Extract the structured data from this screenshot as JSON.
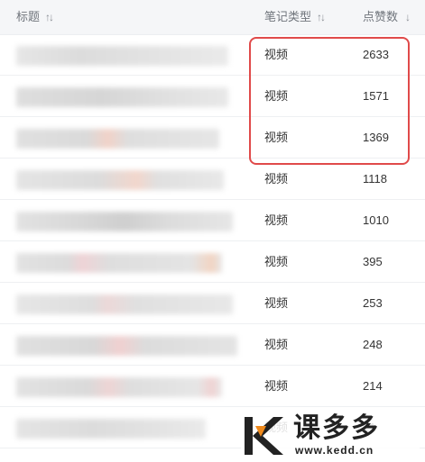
{
  "header": {
    "title_col": "标题",
    "type_col": "笔记类型",
    "likes_col": "点赞数"
  },
  "rows": [
    {
      "type": "视频",
      "likes": "2633"
    },
    {
      "type": "视频",
      "likes": "1571"
    },
    {
      "type": "视频",
      "likes": "1369"
    },
    {
      "type": "视频",
      "likes": "1118"
    },
    {
      "type": "视频",
      "likes": "1010"
    },
    {
      "type": "视频",
      "likes": "395"
    },
    {
      "type": "视频",
      "likes": "253"
    },
    {
      "type": "视频",
      "likes": "248"
    },
    {
      "type": "视频",
      "likes": "214"
    },
    {
      "type": "视频",
      "likes": "21"
    }
  ],
  "highlight_color": "#e04a4a",
  "watermark": {
    "brand": "课多多",
    "url": "www.kedd.cn",
    "logo_accent": "#f08a1c"
  }
}
